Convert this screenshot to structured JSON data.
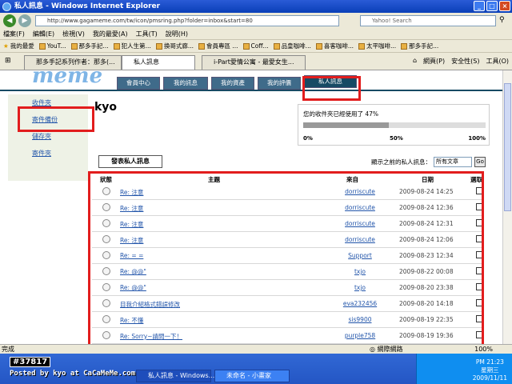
{
  "window": {
    "title": "私人訊息 - Windows Internet Explorer"
  },
  "address": {
    "url": "http://www.gagameme.com/tw/icon/pmsring.php?folder=inbox&start=80",
    "search_placeholder": "Yahoo! Search"
  },
  "menu": [
    "檔案(F)",
    "編輯(E)",
    "檢視(V)",
    "我的最愛(A)",
    "工具(T)",
    "說明(H)"
  ],
  "favorites": [
    "我的最愛",
    "YouT...",
    "那多手記...",
    "犯人生第...",
    "換哥式廊...",
    "會員專區 ...",
    "Coff...",
    "品皇咖啡...",
    "喜客咖啡...",
    "太平咖啡...",
    "那多手記..."
  ],
  "tabs": [
    {
      "label": "那多手記系列作者：那多(..."
    },
    {
      "label": "私人訊息"
    },
    {
      "label": "i-Part愛情公寓 - 最愛女生..."
    }
  ],
  "tab_tools": [
    "網頁(P)",
    "安全性(S)",
    "工具(O)"
  ],
  "site": {
    "logo": "meme",
    "nav": [
      "會員中心",
      "我的訊息",
      "我的資產",
      "我的評價",
      "私人訊息"
    ],
    "left_nav": [
      "收件夾",
      "寄件備份",
      "儲存夾",
      "寄件夾"
    ],
    "username": "kyo",
    "quota_label": "您的收件夾已經使用了 47%",
    "quota_percent": 47,
    "quota_ticks": [
      "0%",
      "50%",
      "100%"
    ],
    "send_button": "發表私人訊息",
    "filter_label": "顯示之前的私人訊息：",
    "filter_value": "所有文章",
    "go_button": "Go",
    "columns": [
      "狀態",
      "主題",
      "來自",
      "日期",
      "選取"
    ]
  },
  "messages": [
    {
      "subject": "Re: 注意",
      "from": "dorriscute",
      "date": "2009-08-24 14:25"
    },
    {
      "subject": "Re: 注意",
      "from": "dorriscute",
      "date": "2009-08-24 12:36"
    },
    {
      "subject": "Re: 注意",
      "from": "dorriscute",
      "date": "2009-08-24 12:31"
    },
    {
      "subject": "Re: 注意",
      "from": "dorriscute",
      "date": "2009-08-24 12:06"
    },
    {
      "subject": "Re: = =",
      "from": "Support",
      "date": "2009-08-23 12:34"
    },
    {
      "subject": "Re: @@\"",
      "from": "txjo",
      "date": "2009-08-22 00:08"
    },
    {
      "subject": "Re: @@\"",
      "from": "txjo",
      "date": "2009-08-20 23:38"
    },
    {
      "subject": "目我介紹格式錯誤修改",
      "from": "eva232456",
      "date": "2009-08-20 14:18"
    },
    {
      "subject": "Re: 不懂",
      "from": "sis9900",
      "date": "2009-08-19 22:35"
    },
    {
      "subject": "Re: Sorry~請問一下！",
      "from": "purple758",
      "date": "2009-08-19 19:36"
    }
  ],
  "status": {
    "left": "完成",
    "zone": "網際網路",
    "zoom": "100%"
  },
  "taskbar": {
    "post_number": "#37817",
    "posted_by": "Posted by kyo at CaCaMeMe.com",
    "tasks": [
      "私人訊息 - Windows...",
      "未命名 - 小畫家"
    ],
    "clock_time": "PM 21:23",
    "clock_day": "星期三",
    "clock_date": "2009/11/11"
  }
}
